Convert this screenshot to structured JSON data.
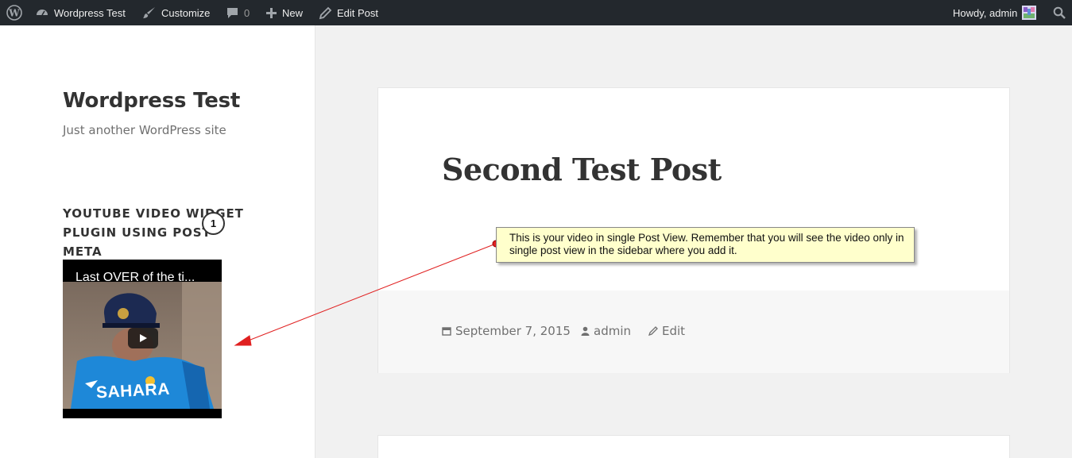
{
  "adminbar": {
    "site_name": "Wordpress Test",
    "customize": "Customize",
    "comments_count": "0",
    "new_label": "New",
    "edit_post": "Edit Post",
    "howdy": "Howdy, admin"
  },
  "sidebar": {
    "site_title": "Wordpress Test",
    "site_description": "Just another WordPress site",
    "widget_title": "YOUTUBE VIDEO WIDGET PLUGIN USING POST META",
    "video": {
      "title": "Last OVER of the ti...",
      "jersey_text": "SAHARA"
    }
  },
  "post": {
    "title": "Second Test Post",
    "date": "September 7, 2015",
    "author": "admin",
    "edit": "Edit"
  },
  "annotation": {
    "step": "1",
    "callout_text": "This is your video in single Post View. Remember that you will see the video only in single post view in the sidebar where you add it."
  },
  "colors": {
    "adminbar_bg": "#23282d",
    "callout_bg": "#ffffcc",
    "arrow": "#e02020",
    "jersey_blue": "#1e88d8"
  }
}
